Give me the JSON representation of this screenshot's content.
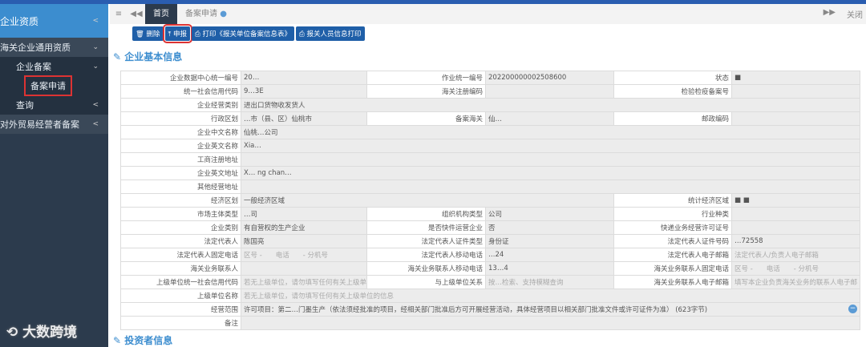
{
  "sidebar": {
    "header": "企业资质",
    "items": [
      {
        "label": "海关企业通用资质",
        "level": 1
      },
      {
        "label": "企业备案",
        "level": 2
      },
      {
        "label": "备案申请",
        "level": 3,
        "selected": true
      },
      {
        "label": "查询",
        "level": 2
      },
      {
        "label": "对外贸易经营者备案",
        "level": 1
      }
    ]
  },
  "tabs": {
    "home": "首页",
    "current": "备案申请",
    "close_others": "关闭"
  },
  "toolbar": {
    "delete": "删除",
    "submit": "申报",
    "print_unit": "打印《报关单位备案信息表》",
    "print_person": "报关人员信息打印"
  },
  "sections": {
    "basic": "企业基本信息",
    "investor": "投资者信息"
  },
  "rows": [
    [
      [
        "企业数据中心统一编号",
        "20…",
        1
      ],
      [
        "作业统一编号",
        "202200000002508600",
        1
      ],
      [
        "状态",
        "■",
        1
      ]
    ],
    [
      [
        "统一社会信用代码",
        "9…3E",
        1
      ],
      [
        "海关注册编码",
        "",
        1
      ],
      [
        "检验检疫备案号",
        "",
        1
      ]
    ],
    [
      [
        "企业经营类别",
        "进出口货物收发货人",
        5
      ]
    ],
    [
      [
        "行政区划",
        "…市（县、区）仙桃市",
        1
      ],
      [
        "备案海关",
        "仙…",
        1
      ],
      [
        "邮政编码",
        "",
        1
      ]
    ],
    [
      [
        "企业中文名称",
        "仙桃…公司",
        5
      ]
    ],
    [
      [
        "企业英文名称",
        "Xia…",
        5
      ]
    ],
    [
      [
        "工商注册地址",
        "",
        5
      ]
    ],
    [
      [
        "企业英文地址",
        "X… ng chan…",
        5
      ]
    ],
    [
      [
        "其他经营地址",
        "",
        5
      ]
    ],
    [
      [
        "经济区划",
        "一般经济区域",
        3
      ],
      [
        "统计经济区域",
        "■ ■",
        1
      ]
    ],
    [
      [
        "市场主体类型",
        "…司",
        1
      ],
      [
        "组织机构类型",
        "公司",
        1
      ],
      [
        "行业种类",
        "",
        1
      ]
    ],
    [
      [
        "企业类别",
        "有自营权的生产企业",
        1
      ],
      [
        "是否快件运营企业",
        "否",
        1
      ],
      [
        "快递业务经营许可证号",
        "",
        1
      ]
    ],
    [
      [
        "法定代表人",
        "陈国亮",
        1
      ],
      [
        "法定代表人证件类型",
        "身份证",
        1
      ],
      [
        "法定代表人证件号码",
        "…72558",
        1
      ]
    ],
    [
      [
        "法定代表人固定电话",
        "区号 -　　电话　　- 分机号",
        1,
        "ph"
      ],
      [
        "法定代表人移动电话",
        "…24",
        1
      ],
      [
        "法定代表人电子邮箱",
        "法定代表人/负责人电子邮箱",
        1,
        "ph"
      ]
    ],
    [
      [
        "海关业务联系人",
        "",
        1
      ],
      [
        "海关业务联系人移动电话",
        "13…4",
        1
      ],
      [
        "海关业务联系人固定电话",
        "区号 -　　电话　　- 分机号",
        1,
        "ph"
      ]
    ],
    [
      [
        "上级单位统一社会信用代码",
        "若无上级单位，请勿填写任何有关上级单",
        1,
        "ph"
      ],
      [
        "与上级单位关系",
        "按…检索、支持模糊查询",
        1,
        "ph"
      ],
      [
        "海关业务联系人电子邮箱",
        "填写本企业负责海关业务的联系人电子邮",
        1,
        "ph"
      ]
    ],
    [
      [
        "上级单位名称",
        "若无上级单位，请勿填写任何有关上级单位的信息",
        5,
        "ph"
      ]
    ],
    [
      [
        "经营范围",
        "许可项目：第二…门墨生产（依法须经批准的项目，经相关部门批准后方可开展经营活动，具体经营项目以相关部门批准文件或许可证件为准） (623字节)",
        5,
        "scope"
      ]
    ],
    [
      [
        "备注",
        "",
        5
      ]
    ]
  ],
  "watermark": "大数跨境"
}
